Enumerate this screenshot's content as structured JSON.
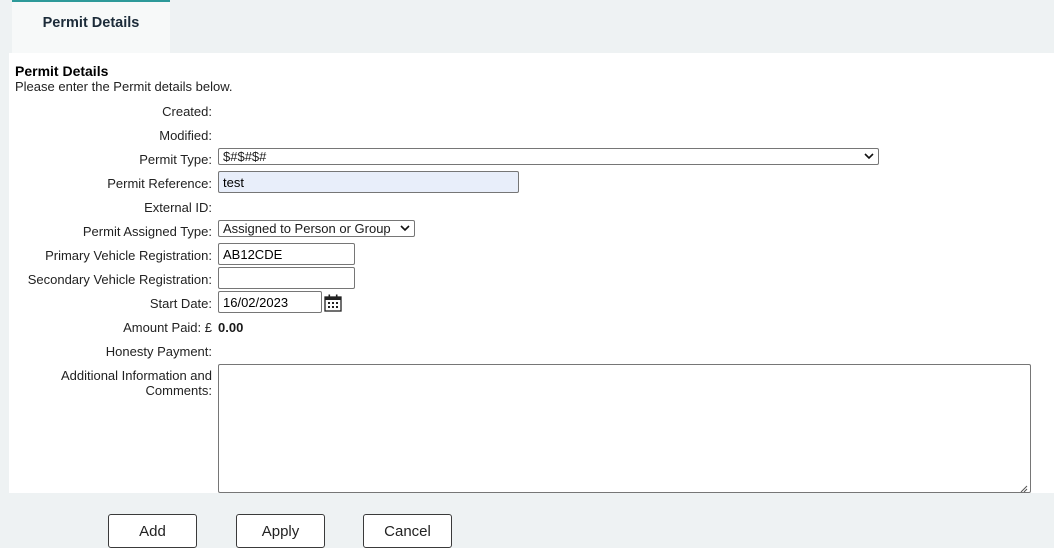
{
  "tab": {
    "label": "Permit Details"
  },
  "section": {
    "title": "Permit Details",
    "subtitle": "Please enter the Permit details below."
  },
  "fields": {
    "created": {
      "label": "Created:",
      "value": ""
    },
    "modified": {
      "label": "Modified:",
      "value": ""
    },
    "permit_type": {
      "label": "Permit Type:",
      "value": "$#$#$#"
    },
    "permit_reference": {
      "label": "Permit Reference:",
      "value": "test"
    },
    "external_id": {
      "label": "External ID:",
      "value": ""
    },
    "permit_assigned_type": {
      "label": "Permit Assigned Type:",
      "value": "Assigned to Person or Group"
    },
    "primary_vehicle_registration": {
      "label": "Primary Vehicle Registration:",
      "value": "AB12CDE"
    },
    "secondary_vehicle_registration": {
      "label": "Secondary Vehicle Registration:",
      "value": ""
    },
    "start_date": {
      "label": "Start Date:",
      "value": "16/02/2023"
    },
    "amount_paid": {
      "label": "Amount Paid: £",
      "value": "0.00"
    },
    "honesty_payment": {
      "label": "Honesty Payment:",
      "value": ""
    },
    "additional_info": {
      "label": "Additional Information and Comments:",
      "value": ""
    }
  },
  "buttons": {
    "add": "Add",
    "apply": "Apply",
    "cancel": "Cancel"
  },
  "icons": {
    "calendar": "calendar-icon",
    "dropdown": "chevron-down-icon",
    "resize": "resize-grip-icon"
  },
  "colors": {
    "tab_accent": "#2e9a9a",
    "page_bg": "#eef2f3",
    "filled_input_bg": "#e8eefa"
  }
}
